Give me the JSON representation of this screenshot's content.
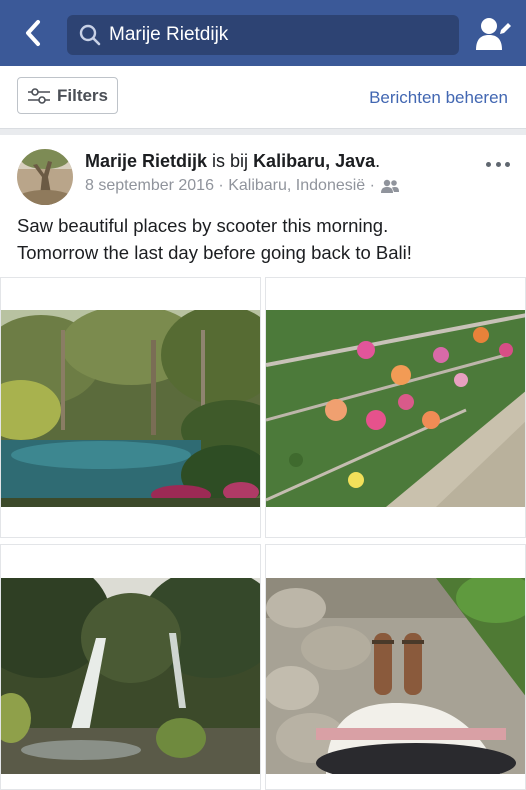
{
  "search": {
    "query": "Marije Rietdijk"
  },
  "toolbar": {
    "filters_label": "Filters",
    "manage_label": "Berichten beheren"
  },
  "post": {
    "author": "Marije Rietdijk",
    "connector": " is bij ",
    "place": "Kalibaru, Java",
    "place_suffix": ".",
    "date": "8 september 2016",
    "sep1": " · ",
    "location": "Kalibaru, Indonesië",
    "sep2": " · ",
    "message_line1": "Saw beautiful places by scooter this morning.",
    "message_line2": "Tomorrow the last day before going back to Bali!"
  },
  "colors": {
    "header_bg": "#3b5998",
    "link": "#4267b2",
    "meta": "#90949c"
  },
  "icons": [
    "back-arrow-icon",
    "search-icon",
    "add-friend-icon",
    "filter-sliders-icon",
    "more-dots-icon",
    "friends-audience-icon"
  ]
}
